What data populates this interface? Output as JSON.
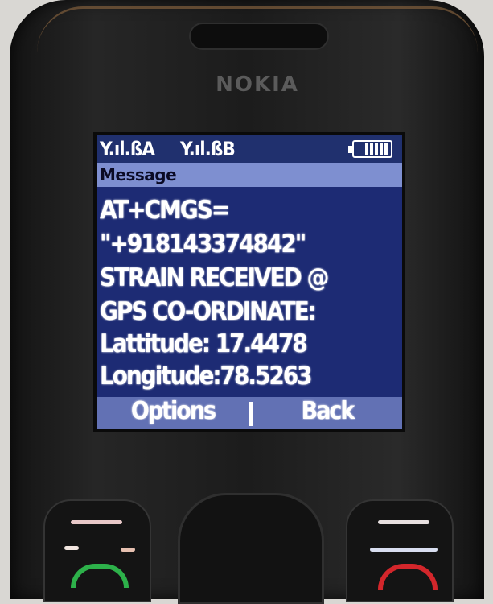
{
  "device": {
    "brand": "NOKIA"
  },
  "status_bar": {
    "sim1_signal": "Y.ıl.ßA",
    "sim2_signal": "Y.ıl.ßB",
    "battery_level": 1.0
  },
  "screen": {
    "title": "Message",
    "lines": [
      "AT+CMGS=",
      "\"+918143374842\"",
      "STRAIN RECEIVED @",
      "GPS CO-ORDINATE:",
      "Lattitude: 17.4478",
      "Longitude:78.5263"
    ]
  },
  "softkeys": {
    "left": "Options",
    "right": "Back"
  },
  "colors": {
    "screen_bg": "#1d2b74",
    "title_bar": "#7e8fd0",
    "softkey_bar": "#6271b4",
    "call_key": "#2db14a",
    "end_key": "#d3262b"
  }
}
